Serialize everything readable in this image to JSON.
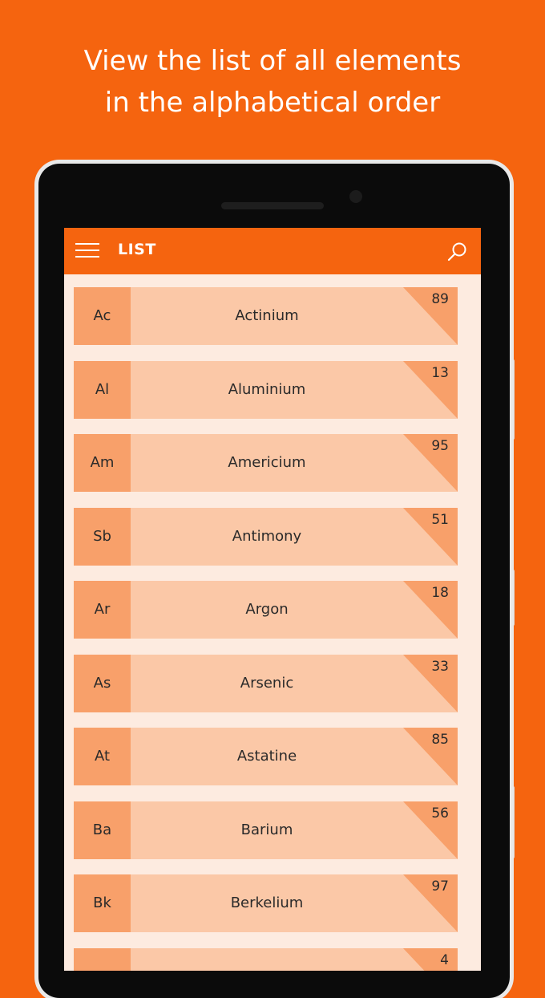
{
  "promo": {
    "line1": "View the list of all elements",
    "line2": "in the alphabetical order"
  },
  "app": {
    "title": "LIST",
    "menu_icon": "hamburger-menu-icon",
    "search_icon": "search-icon"
  },
  "colors": {
    "brand": "#f5640f",
    "symbol_tile": "#f8a06a",
    "row_bg": "#fbc8a7",
    "corner": "#f8a06a",
    "screen_bg": "#fdebe0"
  },
  "elements": [
    {
      "symbol": "Ac",
      "name": "Actinium",
      "number": "89"
    },
    {
      "symbol": "Al",
      "name": "Aluminium",
      "number": "13"
    },
    {
      "symbol": "Am",
      "name": "Americium",
      "number": "95"
    },
    {
      "symbol": "Sb",
      "name": "Antimony",
      "number": "51"
    },
    {
      "symbol": "Ar",
      "name": "Argon",
      "number": "18"
    },
    {
      "symbol": "As",
      "name": "Arsenic",
      "number": "33"
    },
    {
      "symbol": "At",
      "name": "Astatine",
      "number": "85"
    },
    {
      "symbol": "Ba",
      "name": "Barium",
      "number": "56"
    },
    {
      "symbol": "Bk",
      "name": "Berkelium",
      "number": "97"
    },
    {
      "symbol": "",
      "name": "",
      "number": "4"
    }
  ]
}
